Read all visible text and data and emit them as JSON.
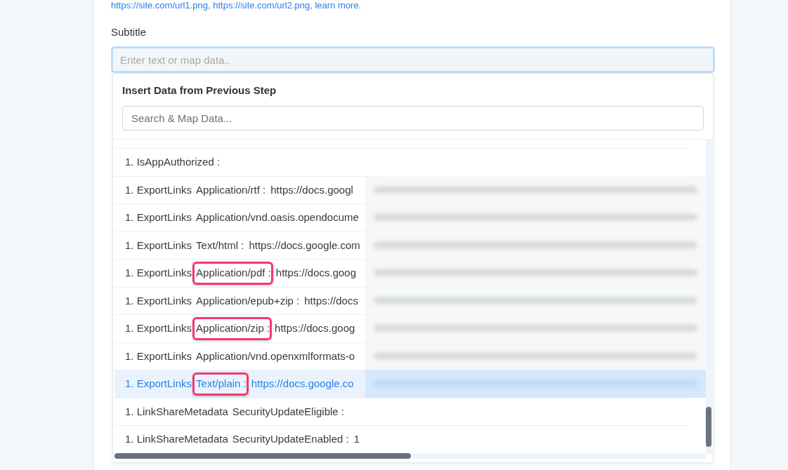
{
  "help_text": "https://site.com/url1.png, https://site.com/url2.png, learn more.",
  "field": {
    "label": "Subtitle",
    "placeholder": "Enter text or map data..",
    "focused": true
  },
  "data_picker": {
    "title": "Insert Data from Previous Step",
    "search": {
      "placeholder": "Search & Map Data..."
    },
    "items": [
      {
        "label": "1. IsAppAuthorized :",
        "selected": false,
        "redacted": false,
        "annotated": false
      },
      {
        "prefix": "1. ExportLinks",
        "label": "Application/rtf :",
        "value": "https://docs.googl",
        "selected": false,
        "redacted": true,
        "annotated": false
      },
      {
        "prefix": "1. ExportLinks",
        "label": "Application/vnd.oasis.opendocume",
        "selected": false,
        "redacted": true,
        "annotated": false
      },
      {
        "prefix": "1. ExportLinks",
        "label": "Text/html :",
        "value": "https://docs.google.com",
        "selected": false,
        "redacted": true,
        "annotated": false
      },
      {
        "prefix": "1. ExportLinks",
        "label": "Application/pdf :",
        "value": "https://docs.goog",
        "selected": false,
        "redacted": true,
        "annotated": true
      },
      {
        "prefix": "1. ExportLinks",
        "label": "Application/epub+zip :",
        "value": "https://docs",
        "selected": false,
        "redacted": true,
        "annotated": false
      },
      {
        "prefix": "1. ExportLinks",
        "label": "Application/zip :",
        "value": "https://docs.goog",
        "selected": false,
        "redacted": true,
        "annotated": true
      },
      {
        "prefix": "1. ExportLinks",
        "label": "Application/vnd.openxmlformats-o",
        "selected": false,
        "redacted": true,
        "annotated": false
      },
      {
        "prefix": "1. ExportLinks",
        "label": "Text/plain :",
        "value": "https://docs.google.co",
        "selected": true,
        "redacted": true,
        "annotated": true
      },
      {
        "prefix": "1. LinkShareMetadata",
        "label": "SecurityUpdateEligible :",
        "selected": false,
        "redacted": false,
        "annotated": false
      },
      {
        "prefix": "1. LinkShareMetadata",
        "label": "SecurityUpdateEnabled :",
        "value": "1",
        "selected": false,
        "redacted": false,
        "annotated": false
      }
    ]
  }
}
